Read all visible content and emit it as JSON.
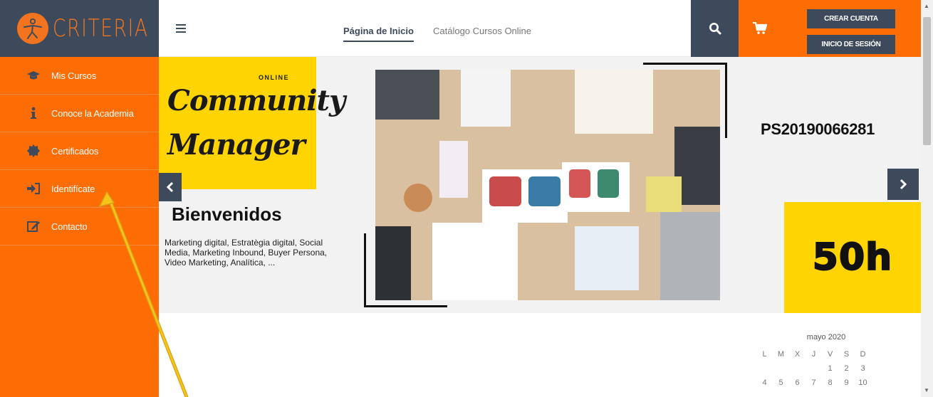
{
  "brand": {
    "logo_text": "CRITERIA",
    "colors": {
      "orange": "#fe6c04",
      "navy": "#3d4a5c",
      "yellow": "#ffd400"
    }
  },
  "sidebar": {
    "items": [
      {
        "label": "Mis Cursos",
        "icon": "graduation-cap-icon"
      },
      {
        "label": "Conoce la Academia",
        "icon": "info-icon"
      },
      {
        "label": "Certificados",
        "icon": "certificate-icon"
      },
      {
        "label": "Identifícate",
        "icon": "sign-in-icon"
      },
      {
        "label": "Contacto",
        "icon": "edit-icon"
      }
    ]
  },
  "topbar": {
    "nav": [
      {
        "label": "Página de Inicio"
      },
      {
        "label": "Catálogo Cursos Online"
      }
    ],
    "create_account_label": "CREAR CUENTA",
    "login_label": "INICIO DE SESIÓN"
  },
  "hero": {
    "online_label": "ONLINE",
    "title_line1": "Community",
    "title_line2": "Manager",
    "welcome_title": "Bienvenidos",
    "welcome_desc": "Marketing digital, Estratègia digital, Social Media, Marketing Inbound, Buyer Persona, Video Marketing, Analítica, ...",
    "course_code": "PS20190066281",
    "hours": "50h"
  },
  "calendar": {
    "title": "mayo 2020",
    "weekdays": [
      "L",
      "M",
      "X",
      "J",
      "V",
      "S",
      "D"
    ],
    "days_row1": [
      "",
      "",
      "",
      "",
      "1",
      "2",
      "3"
    ],
    "days_row2": [
      "4",
      "5",
      "6",
      "7",
      "8",
      "9",
      "10"
    ]
  }
}
